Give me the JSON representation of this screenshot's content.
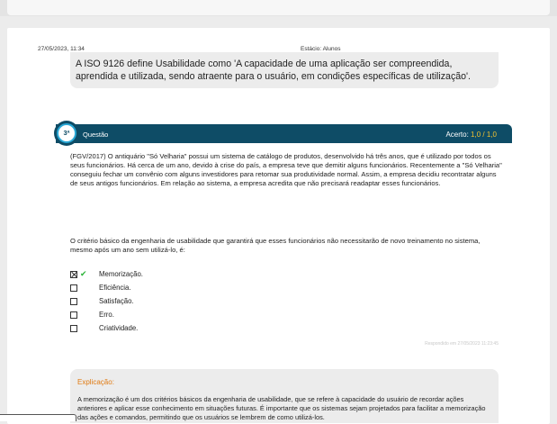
{
  "header": {
    "date": "27/05/2023, 11:34",
    "center": "Estácio: Alunos"
  },
  "previous_question": {
    "answer_text": "A ISO 9126 define Usabilidade como 'A capacidade de uma aplicação ser compreendida, aprendida e utilizada, sendo atraente para o usuário, em condições específicas de utilização'."
  },
  "question": {
    "number": "3ª",
    "label": "Questão",
    "score_label": "Acerto:",
    "score_value": "1,0",
    "score_separator": "/",
    "score_total": "1,0",
    "text": "(FGV/2017) O antiquário \"Só Velharia\" possui um sistema de catálogo de produtos, desenvolvido há três anos, que é utilizado por todos os seus funcionários. Há cerca de um ano, devido à crise do país, a empresa teve que demitir alguns funcionários. Recentemente a \"Só Velharia\" conseguiu fechar um convênio com alguns investidores para retomar sua produtividade normal. Assim, a empresa decidiu recontratar alguns de seus antigos funcionários. Em relação ao sistema, a empresa acredita que não precisará readaptar esses funcionários.",
    "prompt": "O critério básico da engenharia de usabilidade que garantirá que esses funcionários não necessitarão de novo treinamento no sistema, mesmo após um ano sem utilizá-lo, é:",
    "options": [
      {
        "label": "Memorização.",
        "selected": true,
        "correct": true
      },
      {
        "label": "Eficiência.",
        "selected": false,
        "correct": false
      },
      {
        "label": "Satisfação.",
        "selected": false,
        "correct": false
      },
      {
        "label": "Erro.",
        "selected": false,
        "correct": false
      },
      {
        "label": "Criatividade.",
        "selected": false,
        "correct": false
      }
    ],
    "answered_at": "Respondido em 27/05/2023 11:23:45"
  },
  "explanation": {
    "title": "Explicação:",
    "text": "A memorização é um dos critérios básicos da engenharia de usabilidade, que se refere à capacidade do usuário de recordar ações anteriores e aplicar esse conhecimento em situações futuras. É importante que os sistemas sejam projetados para facilitar a memorização das ações e comandos, permitindo que os usuários se lembrem de como utilizá-los."
  },
  "colors": {
    "question_bar": "#0e4c66",
    "badge_ring": "#29a8d6",
    "score_highlight": "#f2c230",
    "correct_check": "#2db43a",
    "explanation_title": "#e07a12"
  }
}
